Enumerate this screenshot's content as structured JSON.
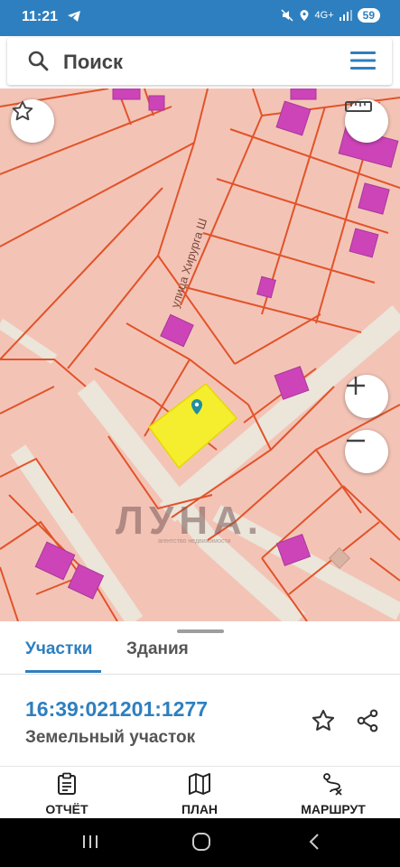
{
  "status": {
    "time": "11:21",
    "battery": "59",
    "network": "4G+"
  },
  "search": {
    "placeholder": "Поиск"
  },
  "map": {
    "street_label": "улица Хирурга Ш",
    "watermark": "ЛУНА.",
    "watermark_sub": "агентство недвижимости",
    "colors": {
      "parcel_fill": "#f3c4b6",
      "boundary": "#e2532a",
      "building": "#cc44b8",
      "selected": "#f4ee2e",
      "road": "#e9e3d8"
    }
  },
  "sheet": {
    "tabs": [
      {
        "label": "Участки"
      },
      {
        "label": "Здания"
      }
    ],
    "parcel": {
      "cadastral_number": "16:39:021201:1277",
      "type": "Земельный участок"
    }
  },
  "bottom_bar": {
    "items": [
      {
        "label": "ОТЧЁТ",
        "icon": "report-icon"
      },
      {
        "label": "ПЛАН",
        "icon": "map-icon"
      },
      {
        "label": "МАРШРУТ",
        "icon": "route-icon"
      }
    ]
  },
  "accent_color": "#2e7fbf"
}
